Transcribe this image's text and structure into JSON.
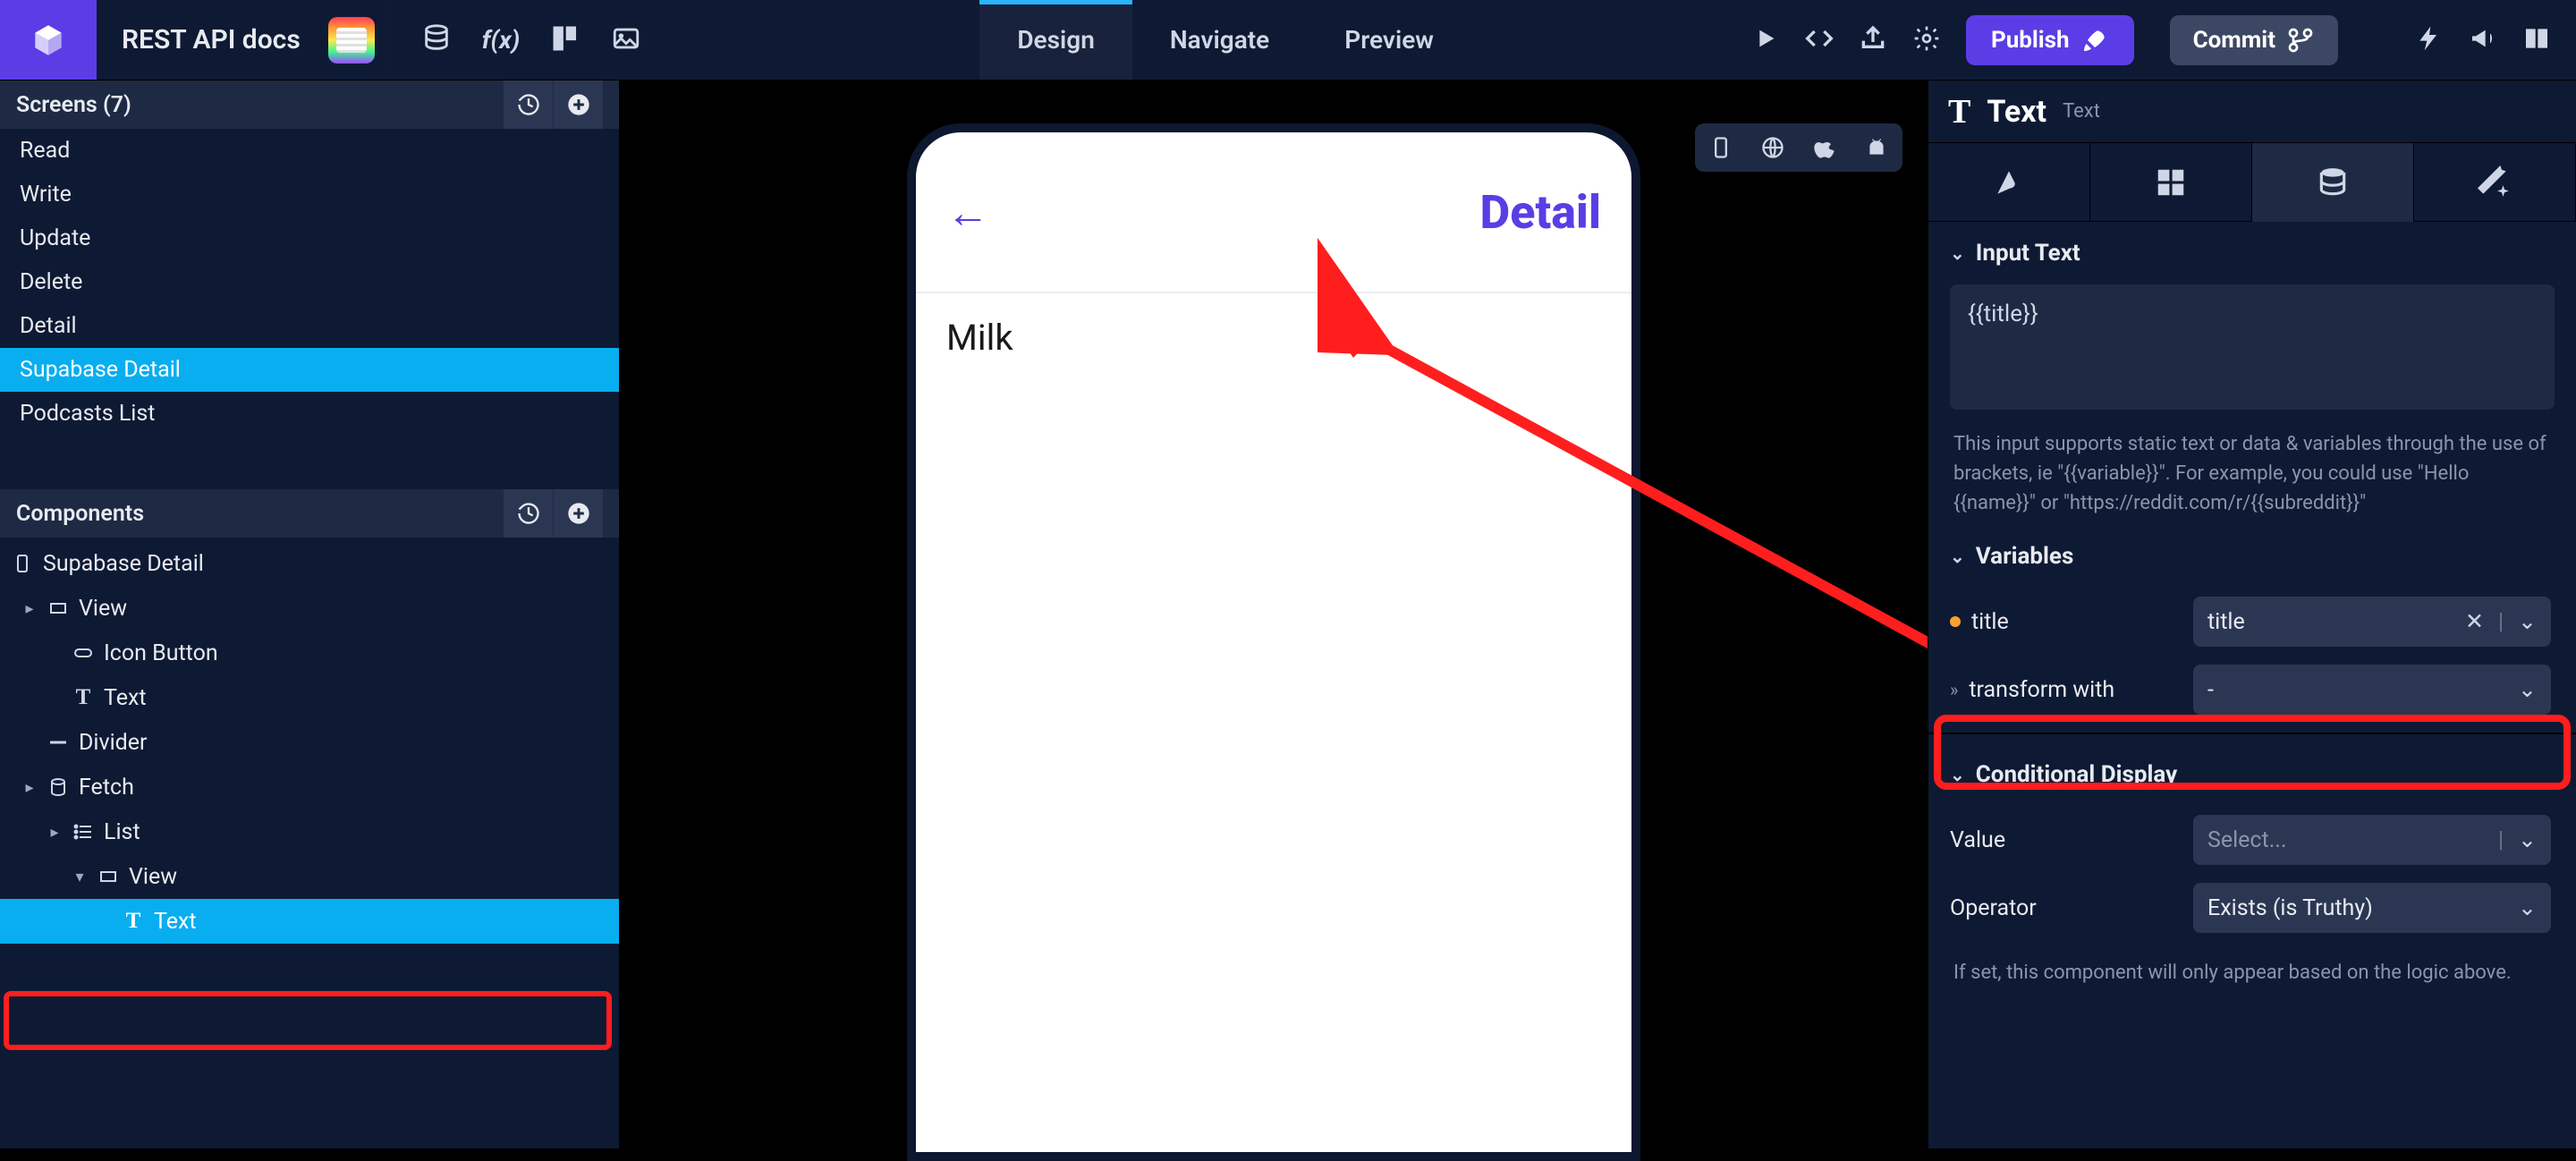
{
  "project_title": "REST API docs",
  "modes": {
    "design": "Design",
    "navigate": "Navigate",
    "preview": "Preview"
  },
  "topbar_buttons": {
    "publish": "Publish",
    "commit": "Commit"
  },
  "screens": {
    "header": "Screens (7)",
    "items": [
      "Read",
      "Write",
      "Update",
      "Delete",
      "Detail",
      "Supabase Detail",
      "Podcasts List"
    ],
    "selected_index": 5
  },
  "components": {
    "header": "Components",
    "tree": [
      {
        "label": "Supabase Detail",
        "icon": "screen",
        "indent": 0,
        "caret": ""
      },
      {
        "label": "View",
        "icon": "rect",
        "indent": 1,
        "caret": "▸"
      },
      {
        "label": "Icon Button",
        "icon": "pill",
        "indent": 2,
        "caret": ""
      },
      {
        "label": "Text",
        "icon": "T",
        "indent": 2,
        "caret": ""
      },
      {
        "label": "Divider",
        "icon": "line",
        "indent": 1,
        "caret": ""
      },
      {
        "label": "Fetch",
        "icon": "db",
        "indent": 1,
        "caret": "▸"
      },
      {
        "label": "List",
        "icon": "list",
        "indent": 2,
        "caret": "▸"
      },
      {
        "label": "View",
        "icon": "rect",
        "indent": 3,
        "caret": "▾"
      },
      {
        "label": "Text",
        "icon": "T",
        "indent": 4,
        "caret": "",
        "selected": true
      }
    ]
  },
  "device": {
    "header_title": "Detail",
    "body_text": "Milk"
  },
  "right_panel": {
    "heading": "Text",
    "heading_sub": "Text",
    "sections": {
      "input_text": {
        "title": "Input Text",
        "value": "{{title}}",
        "help": "This input supports static text or data & variables through the use of brackets, ie \"{{variable}}\". For example, you could use \"Hello {{name}}\" or \"https://reddit.com/r/{{subreddit}}\""
      },
      "variables": {
        "title": "Variables",
        "rows": [
          {
            "label": "title",
            "value": "title",
            "has_dot": true,
            "clearable": true
          },
          {
            "label": "transform with",
            "value": "-",
            "has_chev": true
          }
        ]
      },
      "conditional": {
        "title": "Conditional Display",
        "value_label": "Value",
        "value_placeholder": "Select...",
        "operator_label": "Operator",
        "operator_value": "Exists (is Truthy)",
        "help": "If set, this component will only appear based on the logic above."
      }
    }
  }
}
